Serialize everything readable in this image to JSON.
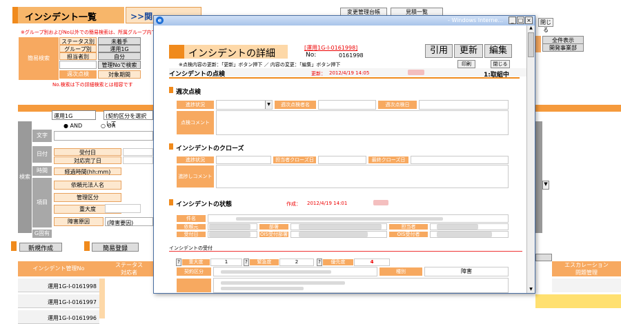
{
  "bg": {
    "page_title": "インシデント一覧",
    "nav_link": ">>関",
    "tabs": [
      "変更管理台帳",
      "見積一覧"
    ],
    "close_label": "閉じる",
    "note1": "※グループ別およびNo以外での簡易検索は、所属グループ内での検索",
    "note2": "No.検索は下の詳細検索とは相容です",
    "quick_search_label": "簡易検索",
    "quick_rows": [
      "ステータス別",
      "グループ別",
      "担当者別"
    ],
    "quick_values": [
      "未着手",
      "運用1G",
      "自分"
    ],
    "admin_search_btn": "管理Noで検索",
    "weekly_check": "週次点検",
    "target_period": "対象期間",
    "right_buttons": [
      "全件表示",
      "開発事業部"
    ],
    "select_group": "運用1G",
    "select_contract": "(契約区分を選択して",
    "radio_and": "AND",
    "radio_or": "OR",
    "search_side_label": "検索",
    "row_labels": [
      "文字",
      "日付",
      "時間",
      "項目",
      "G固有"
    ],
    "date_rows": [
      "受付日",
      "対応完了日"
    ],
    "time_row": "経過時間(hh:mm)",
    "item_rows": [
      "依頼元法人名",
      "管理区分",
      "重大度",
      "障害原因"
    ],
    "fault_cause_value": "(障害要因)",
    "new_button": "新規作成",
    "simple_reg_button": "簡易登録",
    "col_incident_no": "インシデント管理No",
    "col_status": "ステータス",
    "col_handler": "対応者",
    "col_escalation": "エスカレーション",
    "col_problem": "問題管理",
    "rows": [
      "運用1G-I-0161998",
      "運用1G-I-0161997",
      "運用1G-I-0161996"
    ]
  },
  "popup": {
    "window_title": "- Windows Interne...",
    "title": "インシデントの詳細",
    "incident_id": "[運用1G-I-0161998]",
    "no_label": "No:",
    "no_value": "0161998",
    "btn_quote": "引用",
    "btn_update": "更新",
    "btn_edit": "編集",
    "btn_print": "印刷",
    "btn_close": "閉じる",
    "instruction": "※点検内容の更新：「更新」ボタン押下 ／ 内容の変更：「編集」ボタン押下",
    "check_section": "インシデントの点検",
    "updated_label": "更新：",
    "updated_value": "2012/4/19 14:05",
    "status_right": "1:取組中",
    "weekly_section": "週次点検",
    "weekly_labels": [
      "進捗状況",
      "週次点検者名",
      "週次点検日"
    ],
    "check_comment": "点検コメント",
    "close_section": "インシデントのクローズ",
    "close_labels": [
      "進捗状況",
      "担当者クローズ日",
      "最終クローズ日"
    ],
    "progress_comment": "進捗しコメント",
    "state_section": "インシデントの状態",
    "created_label": "作成：",
    "created_value": "2012/4/19 14:01",
    "state_labels": [
      "件名",
      "依頼元",
      "部署",
      "担当者",
      "受付日",
      "OIS受付部署",
      "OIS受付者"
    ],
    "receipt_section": "インシデントの受付",
    "severity_label": "重大度",
    "severity_value": "1",
    "urgency_label": "緊急度",
    "urgency_value": "2",
    "priority_label": "優先度",
    "priority_value": "4",
    "contract_label": "契約区分",
    "type_label": "種別",
    "type_value": "障害"
  }
}
